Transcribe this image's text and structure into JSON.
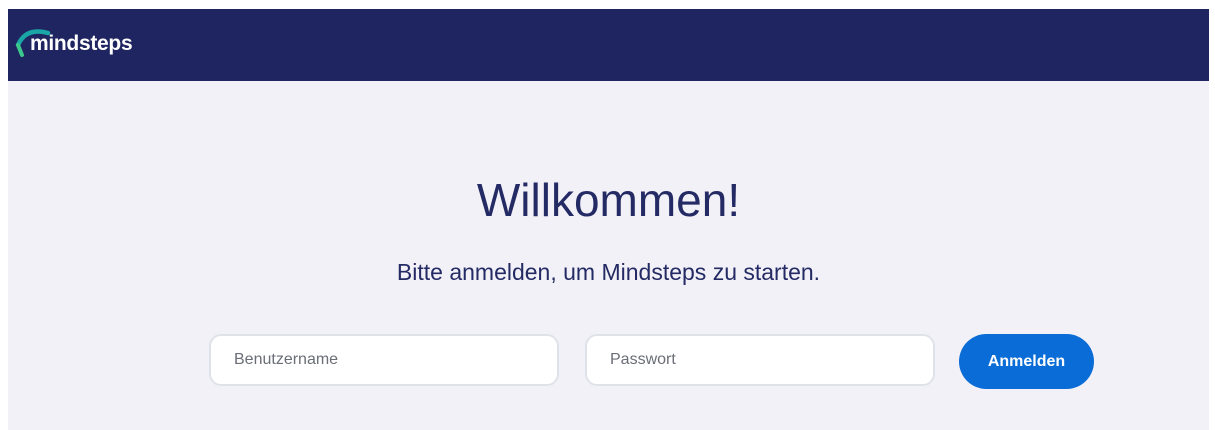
{
  "header": {
    "logo_text": "mindsteps",
    "background_color": "#1f2560",
    "logo_accent_colors": [
      "#1aa6a6",
      "#3cc88c"
    ]
  },
  "main": {
    "title": "Willkommen!",
    "subtitle": "Bitte anmelden, um Mindsteps zu starten.",
    "background_color": "#f2f1f7"
  },
  "login_form": {
    "username": {
      "placeholder": "Benutzername",
      "value": ""
    },
    "password": {
      "placeholder": "Passwort",
      "value": ""
    },
    "submit_label": "Anmelden",
    "submit_color": "#0a6cd6"
  }
}
